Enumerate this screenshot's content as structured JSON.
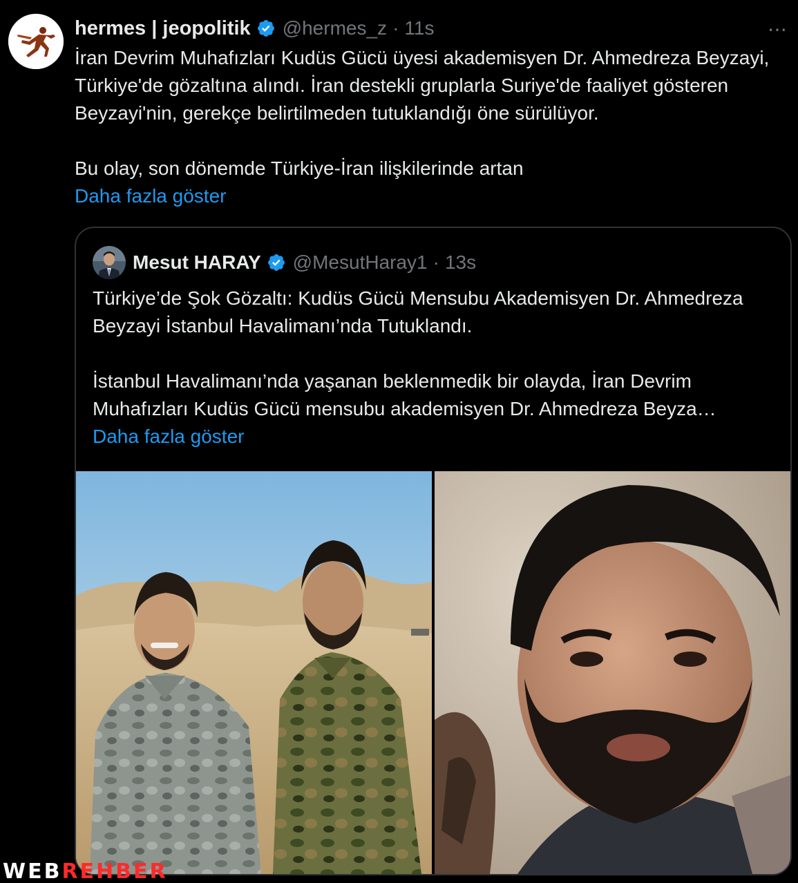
{
  "tweet": {
    "display_name": "hermes | jeopolitik",
    "handle": "@hermes_z",
    "separator": "·",
    "time": "11s",
    "more_icon": "⋯",
    "paragraphs": [
      "İran Devrim Muhafızları Kudüs Gücü üyesi akademisyen Dr. Ahmedreza Beyzayi, Türkiye'de gözaltına alındı. İran destekli gruplarla Suriye'de faaliyet gösteren Beyzayi'nin, gerekçe belirtilmeden tutuklandığı öne sürülüyor.",
      "Bu olay, son dönemde Türkiye-İran ilişkilerinde artan"
    ],
    "show_more": "Daha fazla göster"
  },
  "quoted_tweet": {
    "display_name": "Mesut HARAY",
    "handle": "@MesutHaray1",
    "separator": "·",
    "time": "13s",
    "paragraphs": [
      "Türkiye’de Şok Gözaltı: Kudüs Gücü Mensubu Akademisyen Dr. Ahmedreza Beyzayi İstanbul Havalimanı’nda Tutuklandı.",
      "İstanbul Havalimanı’nda yaşanan beklenmedik bir olayda, İran Devrim Muhafızları Kudüs Gücü mensubu akademisyen Dr. Ahmedreza Beyza…"
    ],
    "show_more": "Daha fazla göster",
    "media": [
      "photo-two-men-in-camouflage",
      "photo-bearded-man-portrait"
    ]
  },
  "watermark": {
    "part1": "WEB",
    "part2": "REHBER"
  },
  "colors": {
    "background": "#000000",
    "text": "#e7e9ea",
    "muted": "#71767b",
    "link": "#1d9bf0",
    "verified": "#1d9bf0",
    "border": "#2f3336"
  }
}
